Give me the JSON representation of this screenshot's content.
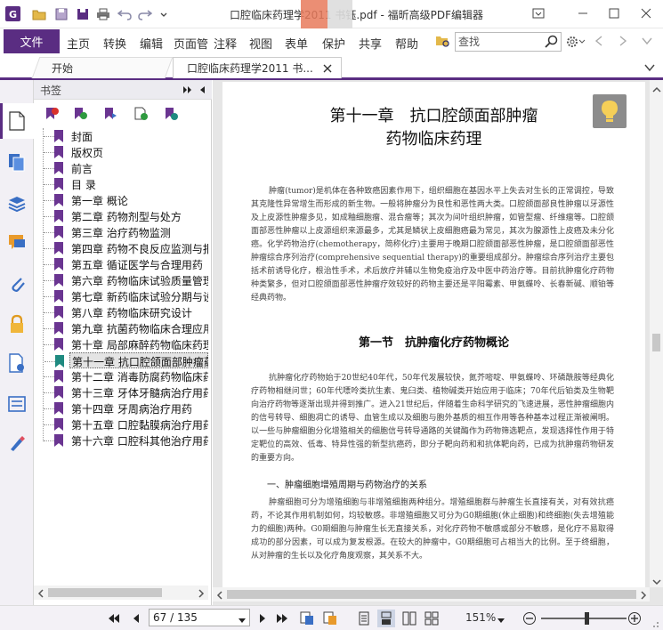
{
  "window": {
    "title": "口腔临床药理学2011 书钰.pdf - 福昕高级PDF编辑器"
  },
  "ribbon": {
    "file_label": "文件",
    "tabs": [
      "主页",
      "转换",
      "编辑",
      "页面管",
      "注释",
      "视图",
      "表单",
      "保护",
      "共享",
      "帮助"
    ],
    "search_placeholder": "查找"
  },
  "doc_tabs": {
    "start_label": "开始",
    "active_label": "口腔临床药理学2011 书..."
  },
  "bookmarks": {
    "header_label": "书签",
    "items": [
      "封面",
      "版权页",
      "前言",
      "目 录",
      "第一章 概论",
      "第二章 药物剂型与处方",
      "第三章 治疗药物监测",
      "第四章 药物不良反应监测与报告",
      "第五章 循证医学与合理用药",
      "第六章 药物临床试验质量管理规范",
      "第七章 新药临床试验分期与设计",
      "第八章 药物临床研究设计",
      "第九章 抗菌药物临床合理应用",
      "第十章 局部麻醉药物临床药理",
      "第十一章 抗口腔颌面部肿瘤药物",
      "第十二章 消毒防腐药物临床药理",
      "第十三章 牙体牙髓病治疗用药",
      "第十四章 牙周病治疗用药",
      "第十五章 口腔黏膜病治疗用药",
      "第十六章 口腔科其他治疗用药"
    ],
    "selected_index": 14
  },
  "document": {
    "chapter_line1": "第十一章　抗口腔颌面部肿瘤",
    "chapter_line2": "药物临床药理",
    "intro": "肿瘤(tumor)是机体在各种致癌因素作用下，组织细胞在基因水平上失去对生长的正常调控，导致其克隆性异常增生而形成的新生物。一般将肿瘤分为良性和恶性两大类。口腔颌面部良性肿瘤以牙源性及上皮源性肿瘤多见，如成釉细胞瘤、混合瘤等；其次为间叶组织肿瘤，如管型瘤、纤维瘤等。口腔颌面部恶性肿瘤以上皮源组织来源最多，尤其是鳞状上皮细胞癌最为常见，其次为腺源性上皮癌及未分化癌。化学药物治疗(chemotherapy，简称化疗)主要用于晚期口腔颌面部恶性肿瘤，是口腔颌面部恶性肿瘤综合序列治疗(comprehensive sequential therapy)的重要组成部分。肿瘤综合序列治疗主要包括术前诱导化疗，根治性手术，术后放疗并辅以生物免疫治疗及中医中药治疗等。目前抗肿瘤化疗药物种类繁多，但对口腔颌面部恶性肿瘤疗效较好的药物主要还是平阳霉素、甲氨蝶呤、长春新碱、顺铂等经典药物。",
    "section_title": "第一节　抗肿瘤化疗药物概论",
    "section_para": "抗肿瘤化疗药物始于20世纪40年代，50年代发展较快，氮芥嘧啶、甲氨蝶呤、环磷酰胺等经典化疗药物相继问世；60年代嘌呤类抗生素、鬼臼类、植物碱类开始应用于临床；70年代后铂类及生物靶向治疗药物等逐渐出现并得到推广。进入21世纪后，伴随着生命科学研究的飞速进展，恶性肿瘤细胞内的信号转导、细胞凋亡的诱导、血管生成以及细胞与胞外基质的相互作用等各种基本过程正渐被阐明。以一些与肿瘤细胞分化增殖相关的细胞信号转导通路的关键酶作为药物筛选靶点，发现选择性作用于特定靶位的高效、低毒、特异性强的新型抗癌药，即分子靶向药和和抗体靶向药，已成为抗肿瘤药物研发的重要方向。",
    "subsection_title": "一、肿瘤细胞增殖周期与药物治疗的关系",
    "subsection_para": "肿瘤细胞可分为增殖细胞与非增殖细胞两种组分。增殖细胞群与肿瘤生长直接有关，对有效抗癌药，不论其作用机制如何，均较敏感。非增殖细胞又可分为G0期细胞(休止细胞)和终细胞(失去增殖能力的细胞)两种。G0期细胞与肿瘤生长无直接关系，对化疗药物不敏感或部分不敏感，是化疗不易取得成功的部分因素，可以成为复发根源。在较大的肿瘤中，G0期细胞可占相当大的比例。至于终细胞，从对肿瘤的生长以及化疗角度观察，其关系不大。"
  },
  "status": {
    "page_field": "67 / 135",
    "zoom": "151%"
  },
  "colors": {
    "accent": "#5a2d82",
    "bookmark_flag": "#6a3591",
    "bookmark_flag_selected": "#1f8a80"
  }
}
